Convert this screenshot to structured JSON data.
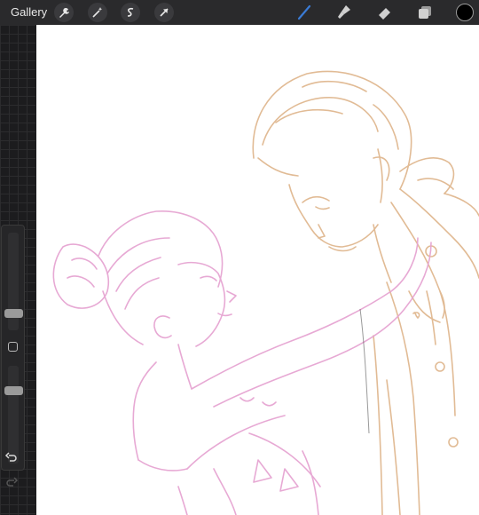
{
  "topbar": {
    "gallery_label": "Gallery",
    "left_tools": [
      {
        "name": "wrench-icon"
      },
      {
        "name": "magic-wand-icon"
      },
      {
        "name": "selection-s-icon"
      },
      {
        "name": "transform-arrow-icon"
      }
    ],
    "right_tools": [
      {
        "name": "brush-icon",
        "color": "#3a7bd5"
      },
      {
        "name": "smudge-icon",
        "color": "#d0d0d0"
      },
      {
        "name": "eraser-icon",
        "color": "#d0d0d0"
      },
      {
        "name": "layers-icon",
        "color": "#d0d0d0"
      }
    ],
    "current_color": "#000000"
  },
  "sidebar": {
    "undo_icon": "undo-icon",
    "redo_icon": "redo-icon",
    "modify_icon": "square-modify-icon"
  },
  "colors": {
    "sketch_pink": "#e6a5d2",
    "sketch_orange": "#deb48a",
    "canvas_bg": "#ffffff",
    "ui_dark": "#1c1c1e"
  }
}
